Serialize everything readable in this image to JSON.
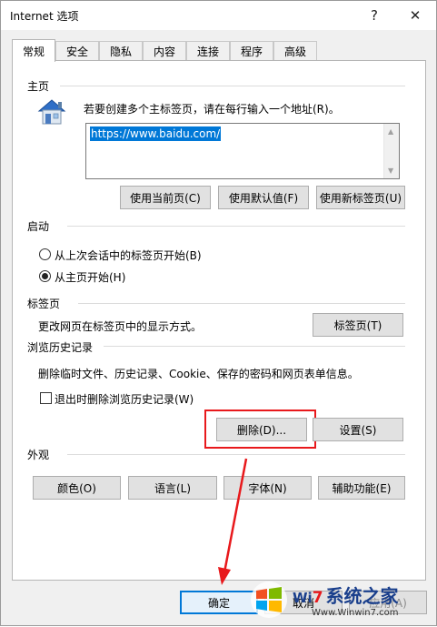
{
  "window": {
    "title": "Internet 选项",
    "help_glyph": "?",
    "close_glyph": "✕"
  },
  "tabs": [
    {
      "label": "常规",
      "active": true
    },
    {
      "label": "安全"
    },
    {
      "label": "隐私"
    },
    {
      "label": "内容"
    },
    {
      "label": "连接"
    },
    {
      "label": "程序"
    },
    {
      "label": "高级"
    }
  ],
  "home": {
    "section": "主页",
    "instruction": "若要创建多个主标签页，请在每行输入一个地址(R)。",
    "url": "https://www.baidu.com/",
    "buttons": {
      "use_current": "使用当前页(C)",
      "use_default": "使用默认值(F)",
      "use_new_tab": "使用新标签页(U)"
    }
  },
  "startup": {
    "section": "启动",
    "option_last_session": "从上次会话中的标签页开始(B)",
    "option_home": "从主页开始(H)",
    "selected": "home"
  },
  "tabs_section": {
    "section": "标签页",
    "description": "更改网页在标签页中的显示方式。",
    "button": "标签页(T)"
  },
  "history": {
    "section": "浏览历史记录",
    "description": "删除临时文件、历史记录、Cookie、保存的密码和网页表单信息。",
    "checkbox_label": "退出时删除浏览历史记录(W)",
    "checkbox_checked": false,
    "delete_button": "删除(D)...",
    "settings_button": "设置(S)"
  },
  "appearance": {
    "section": "外观",
    "colors_button": "颜色(O)",
    "languages_button": "语言(L)",
    "fonts_button": "字体(N)",
    "accessibility_button": "辅助功能(E)"
  },
  "footer": {
    "ok_button": "确定",
    "cancel_button": "取消",
    "apply_button": "应用(A)"
  },
  "watermark": {
    "text": "系统之家",
    "win_prefix": "Wi",
    "win_suffix": "7",
    "site": "Www.Winwin7.com"
  },
  "colors": {
    "highlight_red": "#e8191c",
    "selection_blue": "#0078d7"
  }
}
